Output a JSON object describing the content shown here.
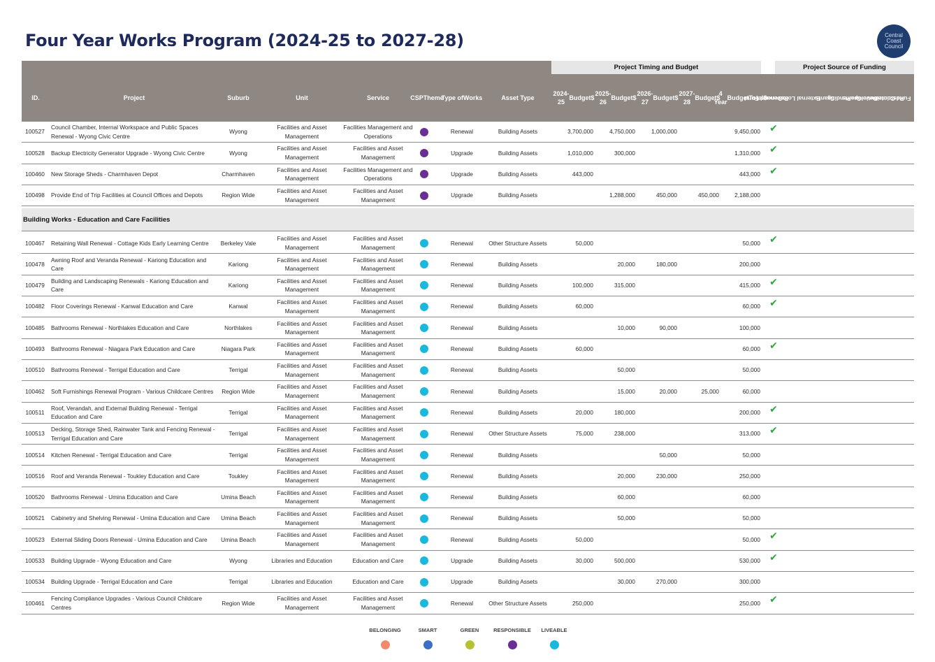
{
  "title": "Four Year Works Program (2024-25 to 2027-28)",
  "logo": {
    "lines": [
      "Central",
      "Coast",
      "Council"
    ]
  },
  "groups": {
    "timing": "Project Timing and Budget",
    "funding": "Project Source of Funding"
  },
  "columns": {
    "id": "ID.",
    "project": "Project",
    "suburb": "Suburb",
    "unit": "Unit",
    "service": "Service",
    "csp": [
      "CSP",
      "Theme"
    ],
    "type": [
      "Type of",
      "Works"
    ],
    "asset": "Asset Type",
    "y1": [
      "2024-25",
      "Budget",
      "$"
    ],
    "y2": [
      "2025-26",
      "Budget",
      "$"
    ],
    "y3": [
      "2026-27",
      "Budget",
      "$"
    ],
    "y4": [
      "2027-28",
      "Budget",
      "$"
    ],
    "total": [
      "4 Year",
      "Budget",
      "Total",
      "$"
    ],
    "gf": [
      "General Fund",
      "Revenue"
    ],
    "loans": [
      "External Loans"
    ],
    "grants": [
      "Grants"
    ],
    "pending": [
      "Pending",
      "Grants"
    ],
    "dev": [
      "Developer",
      "Contributions"
    ],
    "restricted": [
      "Restricted",
      "Funds"
    ]
  },
  "theme_colors": {
    "belonging": "#f08a6a",
    "smart": "#3b6fc4",
    "green": "#b5c234",
    "responsible": "#6a2f95",
    "liveable": "#1ab8dc"
  },
  "check_glyph": "✔",
  "rows_top": [
    {
      "id": "100527",
      "project": "Council Chamber, Internal Workspace and Public Spaces Renewal - Wyong Civic Centre",
      "suburb": "Wyong",
      "unit": "Facilities and Asset Management",
      "service": "Facilities Management and Operations",
      "theme": "responsible",
      "type": "Renewal",
      "asset": "Building Assets",
      "y1": "3,700,000",
      "y2": "4,750,000",
      "y3": "1,000,000",
      "y4": "",
      "total": "9,450,000",
      "gf": true
    },
    {
      "id": "100528",
      "project": "Backup Electricity Generator Upgrade - Wyong Civic Centre",
      "suburb": "Wyong",
      "unit": "Facilities and Asset Management",
      "service": "Facilities and Asset Management",
      "theme": "responsible",
      "type": "Upgrade",
      "asset": "Building Assets",
      "y1": "1,010,000",
      "y2": "300,000",
      "y3": "",
      "y4": "",
      "total": "1,310,000",
      "gf": true
    },
    {
      "id": "100460",
      "project": "New Storage Sheds - Charmhaven Depot",
      "suburb": "Charmhaven",
      "unit": "Facilities and Asset Management",
      "service": "Facilities Management and Operations",
      "theme": "responsible",
      "type": "Upgrade",
      "asset": "Building Assets",
      "y1": "443,000",
      "y2": "",
      "y3": "",
      "y4": "",
      "total": "443,000",
      "gf": true
    },
    {
      "id": "100498",
      "project": "Provide End of Trip Facilities at Council Offices and Depots",
      "suburb": "Region Wide",
      "unit": "Facilities and Asset Management",
      "service": "Facilities and Asset Management",
      "theme": "responsible",
      "type": "Upgrade",
      "asset": "Building Assets",
      "y1": "",
      "y2": "1,288,000",
      "y3": "450,000",
      "y4": "450,000",
      "total": "2,188,000",
      "gf": false
    }
  ],
  "section": "Building Works - Education and Care Facilities",
  "rows_bottom": [
    {
      "id": "100467",
      "project": "Retaining Wall Renewal - Cottage Kids Early Learning Centre",
      "suburb": "Berkeley Vale",
      "unit": "Facilities and Asset Management",
      "service": "Facilities and Asset Management",
      "theme": "liveable",
      "type": "Renewal",
      "asset": "Other Structure Assets",
      "y1": "50,000",
      "y2": "",
      "y3": "",
      "y4": "",
      "total": "50,000",
      "gf": true
    },
    {
      "id": "100478",
      "project": "Awning Roof and Veranda Renewal - Kariong Education and Care",
      "suburb": "Kariong",
      "unit": "Facilities and Asset Management",
      "service": "Facilities and Asset Management",
      "theme": "liveable",
      "type": "Renewal",
      "asset": "Building Assets",
      "y1": "",
      "y2": "20,000",
      "y3": "180,000",
      "y4": "",
      "total": "200,000",
      "gf": false
    },
    {
      "id": "100479",
      "project": "Building and Landscaping Renewals - Kariong Education and Care",
      "suburb": "Kariong",
      "unit": "Facilities and Asset Management",
      "service": "Facilities and Asset Management",
      "theme": "liveable",
      "type": "Renewal",
      "asset": "Building Assets",
      "y1": "100,000",
      "y2": "315,000",
      "y3": "",
      "y4": "",
      "total": "415,000",
      "gf": true
    },
    {
      "id": "100482",
      "project": "Floor Coverings Renewal - Kanwal Education and Care",
      "suburb": "Kanwal",
      "unit": "Facilities and Asset Management",
      "service": "Facilities and Asset Management",
      "theme": "liveable",
      "type": "Renewal",
      "asset": "Building Assets",
      "y1": "60,000",
      "y2": "",
      "y3": "",
      "y4": "",
      "total": "60,000",
      "gf": true
    },
    {
      "id": "100485",
      "project": "Bathrooms Renewal - Northlakes Education and Care",
      "suburb": "Northlakes",
      "unit": "Facilities and Asset Management",
      "service": "Facilities and Asset Management",
      "theme": "liveable",
      "type": "Renewal",
      "asset": "Building Assets",
      "y1": "",
      "y2": "10,000",
      "y3": "90,000",
      "y4": "",
      "total": "100,000",
      "gf": false
    },
    {
      "id": "100493",
      "project": "Bathrooms Renewal - Niagara Park Education and Care",
      "suburb": "Niagara Park",
      "unit": "Facilities and Asset Management",
      "service": "Facilities and Asset Management",
      "theme": "liveable",
      "type": "Renewal",
      "asset": "Building Assets",
      "y1": "60,000",
      "y2": "",
      "y3": "",
      "y4": "",
      "total": "60,000",
      "gf": true
    },
    {
      "id": "100510",
      "project": "Bathrooms Renewal - Terrigal Education and Care",
      "suburb": "Terrigal",
      "unit": "Facilities and Asset Management",
      "service": "Facilities and Asset Management",
      "theme": "liveable",
      "type": "Renewal",
      "asset": "Building Assets",
      "y1": "",
      "y2": "50,000",
      "y3": "",
      "y4": "",
      "total": "50,000",
      "gf": false
    },
    {
      "id": "100462",
      "project": "Soft Furnishings Renewal Program - Various Childcare Centres",
      "suburb": "Region Wide",
      "unit": "Facilities and Asset Management",
      "service": "Facilities and Asset Management",
      "theme": "liveable",
      "type": "Renewal",
      "asset": "Building Assets",
      "y1": "",
      "y2": "15,000",
      "y3": "20,000",
      "y4": "25,000",
      "total": "60,000",
      "gf": false
    },
    {
      "id": "100511",
      "project": "Roof, Verandah, and External Building Renewal - Terrigal Education and Care",
      "suburb": "Terrigal",
      "unit": "Facilities and Asset Management",
      "service": "Facilities and Asset Management",
      "theme": "liveable",
      "type": "Renewal",
      "asset": "Building Assets",
      "y1": "20,000",
      "y2": "180,000",
      "y3": "",
      "y4": "",
      "total": "200,000",
      "gf": true
    },
    {
      "id": "100513",
      "project": "Decking, Storage Shed, Rainwater Tank and Fencing Renewal - Terrigal Education and Care",
      "suburb": "Terrigal",
      "unit": "Facilities and Asset Management",
      "service": "Facilities and Asset Management",
      "theme": "liveable",
      "type": "Renewal",
      "asset": "Other Structure Assets",
      "y1": "75,000",
      "y2": "238,000",
      "y3": "",
      "y4": "",
      "total": "313,000",
      "gf": true
    },
    {
      "id": "100514",
      "project": "Kitchen Renewal - Terrigal Education and Care",
      "suburb": "Terrigal",
      "unit": "Facilities and Asset Management",
      "service": "Facilities and Asset Management",
      "theme": "liveable",
      "type": "Renewal",
      "asset": "Building Assets",
      "y1": "",
      "y2": "",
      "y3": "50,000",
      "y4": "",
      "total": "50,000",
      "gf": false
    },
    {
      "id": "100516",
      "project": "Roof and Veranda Renewal - Toukley Education and Care",
      "suburb": "Toukley",
      "unit": "Facilities and Asset Management",
      "service": "Facilities and Asset Management",
      "theme": "liveable",
      "type": "Renewal",
      "asset": "Building Assets",
      "y1": "",
      "y2": "20,000",
      "y3": "230,000",
      "y4": "",
      "total": "250,000",
      "gf": false
    },
    {
      "id": "100520",
      "project": "Bathrooms Renewal - Umina Education and Care",
      "suburb": "Umina Beach",
      "unit": "Facilities and Asset Management",
      "service": "Facilities and Asset Management",
      "theme": "liveable",
      "type": "Renewal",
      "asset": "Building Assets",
      "y1": "",
      "y2": "60,000",
      "y3": "",
      "y4": "",
      "total": "60,000",
      "gf": false
    },
    {
      "id": "100521",
      "project": "Cabinetry and Shelving Renewal - Umina Education and Care",
      "suburb": "Umina Beach",
      "unit": "Facilities and Asset Management",
      "service": "Facilities and Asset Management",
      "theme": "liveable",
      "type": "Renewal",
      "asset": "Building Assets",
      "y1": "",
      "y2": "50,000",
      "y3": "",
      "y4": "",
      "total": "50,000",
      "gf": false
    },
    {
      "id": "100523",
      "project": "External Sliding Doors Renewal - Umina Education and Care",
      "suburb": "Umina Beach",
      "unit": "Facilities and Asset Management",
      "service": "Facilities and Asset Management",
      "theme": "liveable",
      "type": "Renewal",
      "asset": "Building Assets",
      "y1": "50,000",
      "y2": "",
      "y3": "",
      "y4": "",
      "total": "50,000",
      "gf": true
    },
    {
      "id": "100533",
      "project": "Building Upgrade - Wyong Education and Care",
      "suburb": "Wyong",
      "unit": "Libraries and Education",
      "service": "Education and Care",
      "theme": "liveable",
      "type": "Upgrade",
      "asset": "Building Assets",
      "y1": "30,000",
      "y2": "500,000",
      "y3": "",
      "y4": "",
      "total": "530,000",
      "gf": true
    },
    {
      "id": "100534",
      "project": "Building Upgrade - Terrigal Education and Care",
      "suburb": "Terrigal",
      "unit": "Libraries and Education",
      "service": "Education and Care",
      "theme": "liveable",
      "type": "Upgrade",
      "asset": "Building Assets",
      "y1": "",
      "y2": "30,000",
      "y3": "270,000",
      "y4": "",
      "total": "300,000",
      "gf": false
    },
    {
      "id": "100461",
      "project": "Fencing Compliance Upgrades - Various Council Childcare Centres",
      "suburb": "Region Wide",
      "unit": "Facilities and Asset Management",
      "service": "Facilities and Asset Management",
      "theme": "liveable",
      "type": "Renewal",
      "asset": "Other Structure Assets",
      "y1": "250,000",
      "y2": "",
      "y3": "",
      "y4": "",
      "total": "250,000",
      "gf": true
    }
  ],
  "legend": [
    {
      "key": "belonging",
      "label": "BELONGING"
    },
    {
      "key": "smart",
      "label": "SMART"
    },
    {
      "key": "green",
      "label": "GREEN"
    },
    {
      "key": "responsible",
      "label": "RESPONSIBLE"
    },
    {
      "key": "liveable",
      "label": "LIVEABLE"
    }
  ]
}
